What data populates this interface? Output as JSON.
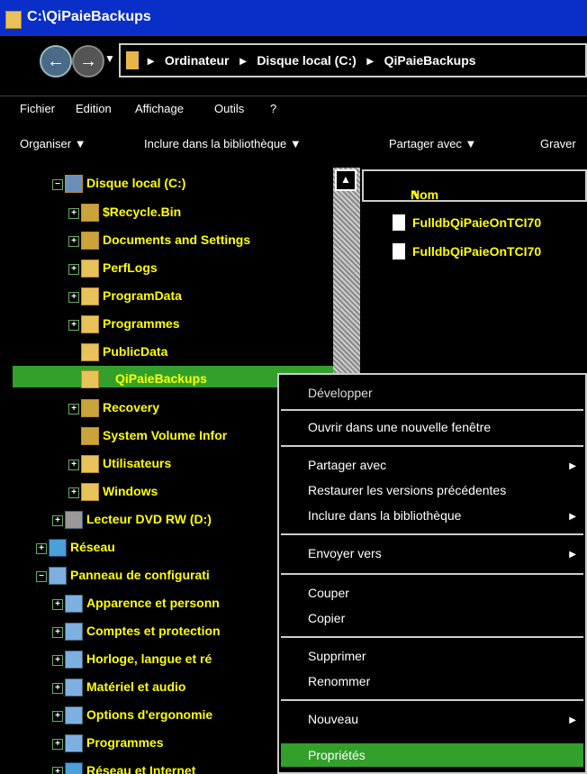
{
  "window": {
    "title": "C:\\QiPaieBackups"
  },
  "address": {
    "crumbs": [
      "Ordinateur",
      "Disque local (C:)",
      "QiPaieBackups"
    ]
  },
  "menu": [
    "Fichier",
    "Edition",
    "Affichage",
    "Outils",
    "?"
  ],
  "toolbar": [
    "Organiser",
    "Inclure dans la bibliothèque",
    "Partager avec",
    "Graver"
  ],
  "tree": [
    {
      "label": "Disque local (C:)",
      "expander": "−"
    },
    {
      "label": "$Recycle.Bin",
      "expander": "+"
    },
    {
      "label": "Documents and Settings",
      "expander": "+"
    },
    {
      "label": "PerfLogs",
      "expander": "+"
    },
    {
      "label": "ProgramData",
      "expander": "+"
    },
    {
      "label": "Programmes",
      "expander": "+"
    },
    {
      "label": "PublicData",
      "expander": ""
    },
    {
      "label": "QiPaieBackups",
      "expander": ""
    },
    {
      "label": "Recovery",
      "expander": "+"
    },
    {
      "label": "System Volume Infor",
      "expander": ""
    },
    {
      "label": "Utilisateurs",
      "expander": "+"
    },
    {
      "label": "Windows",
      "expander": "+"
    },
    {
      "label": "Lecteur DVD RW (D:)",
      "expander": "+"
    },
    {
      "label": "Réseau",
      "expander": "+"
    },
    {
      "label": "Panneau de configurati",
      "expander": "−"
    },
    {
      "label": "Apparence et personn",
      "expander": "+"
    },
    {
      "label": "Comptes et protection",
      "expander": "+"
    },
    {
      "label": "Horloge, langue et ré",
      "expander": "+"
    },
    {
      "label": "Matériel et audio",
      "expander": "+"
    },
    {
      "label": "Options d'ergonomie",
      "expander": "+"
    },
    {
      "label": "Programmes",
      "expander": "+"
    },
    {
      "label": "Réseau et Internet",
      "expander": "+"
    }
  ],
  "content": {
    "column": "Nom",
    "sort_glyph": "^",
    "files": [
      "FulldbQiPaieOnTCI70",
      "FulldbQiPaieOnTCI70"
    ]
  },
  "context_menu": [
    "Développer",
    "Ouvrir dans une nouvelle fenêtre",
    "Partager avec",
    "Restaurer les versions précédentes",
    "Inclure dans la bibliothèque",
    "Envoyer vers",
    "Couper",
    "Copier",
    "Supprimer",
    "Renommer",
    "Nouveau",
    "Propriétés"
  ],
  "colors": {
    "highlight": "#33a02c",
    "text": "#ffff00",
    "title": "#0a2fc8"
  }
}
